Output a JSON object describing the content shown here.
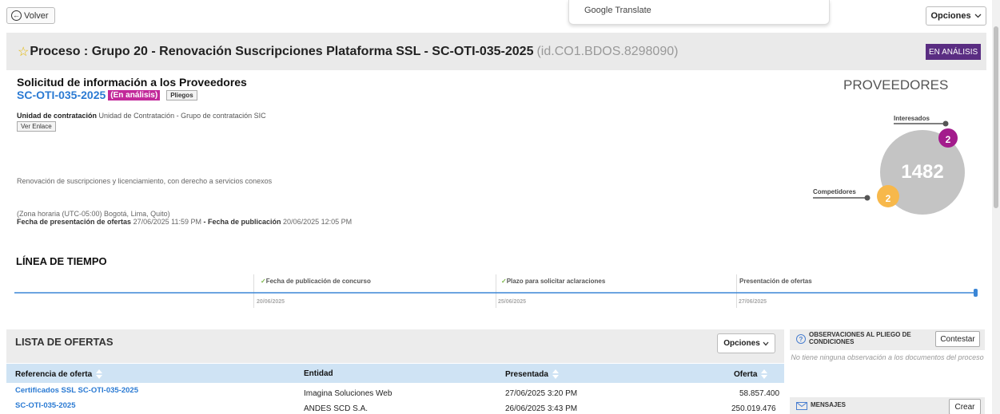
{
  "topbar": {
    "back_label": "Volver",
    "translate_label": "Google Translate",
    "options_label": "Opciones"
  },
  "process": {
    "title": "Proceso : Grupo 20 - Renovación Suscripciones Plataforma SSL - SC-OTI-035-2025",
    "id": "(id.CO1.BDOS.8298090)",
    "status": "EN ANÁLISIS"
  },
  "solicitud": {
    "title": "Solicitud de información a los Proveedores",
    "code": "SC-OTI-035-2025",
    "tag": "(En análisis)",
    "pliegos_label": "Pliegos",
    "unit_label": "Unidad de contratación",
    "unit_value": "Unidad de Contratación - Grupo de contratación SIC",
    "link_label": "Ver Enlace",
    "description": "Renovación de suscripciones y licenciamiento, con derecho a servicios conexos",
    "timezone": "(Zona horaria (UTC-05:00) Bogotá, Lima, Quito)",
    "presentation_label": "Fecha de presentación de ofertas",
    "presentation_value": "27/06/2025 11:59 PM",
    "separator": "-",
    "publication_label": "Fecha de publicación",
    "publication_value": "20/06/2025 12:05 PM"
  },
  "proveedores": {
    "title": "PROVEEDORES",
    "total": "1482",
    "interesados_label": "Interesados",
    "interesados_count": "2",
    "competidores_label": "Competidores",
    "competidores_count": "2"
  },
  "timeline": {
    "title": "LÍNEA DE TIEMPO",
    "events": [
      {
        "label": "Fecha de publicación de concurso",
        "date": "20/06/2025",
        "done": true
      },
      {
        "label": "Plazo para solicitar aclaraciones",
        "date": "25/06/2025",
        "done": true
      },
      {
        "label": "Presentación de ofertas",
        "date": "27/06/2025",
        "done": false
      }
    ],
    "check_glyph": "✓"
  },
  "offers": {
    "title": "LISTA DE OFERTAS",
    "options_label": "Opciones",
    "columns": [
      "Referencia de oferta",
      "Entidad",
      "Presentada",
      "Oferta"
    ],
    "rows": [
      {
        "ref": "Certificados SSL SC-OTI-035-2025",
        "entity": "Imagina Soluciones Web",
        "date": "27/06/2025 3:20 PM",
        "amount": "58.857.400"
      },
      {
        "ref": "SC-OTI-035-2025",
        "entity": "ANDES SCD S.A.",
        "date": "26/06/2025 3:43 PM",
        "amount": "250.019.476"
      }
    ]
  },
  "observations": {
    "title": "OBSERVACIONES AL PLIEGO DE CONDICIONES",
    "button": "Contestar",
    "empty": "No tiene ninguna observación a los documentos del proceso",
    "icon_glyph": "?"
  },
  "messages": {
    "title": "MENSAJES",
    "button": "Crear"
  },
  "colors": {
    "status_bg": "#5a2d82",
    "tag_bg": "#c2299a",
    "link_blue": "#2a7ad3",
    "interesados": "#a31b8c",
    "competidores": "#f7b84b",
    "total_circle": "#c4c4c4"
  },
  "icons": {
    "back": "arrow-left-circle-icon",
    "star": "star-icon",
    "chevron": "chevron-down-icon",
    "help": "help-circle-icon",
    "mail": "envelope-icon"
  }
}
